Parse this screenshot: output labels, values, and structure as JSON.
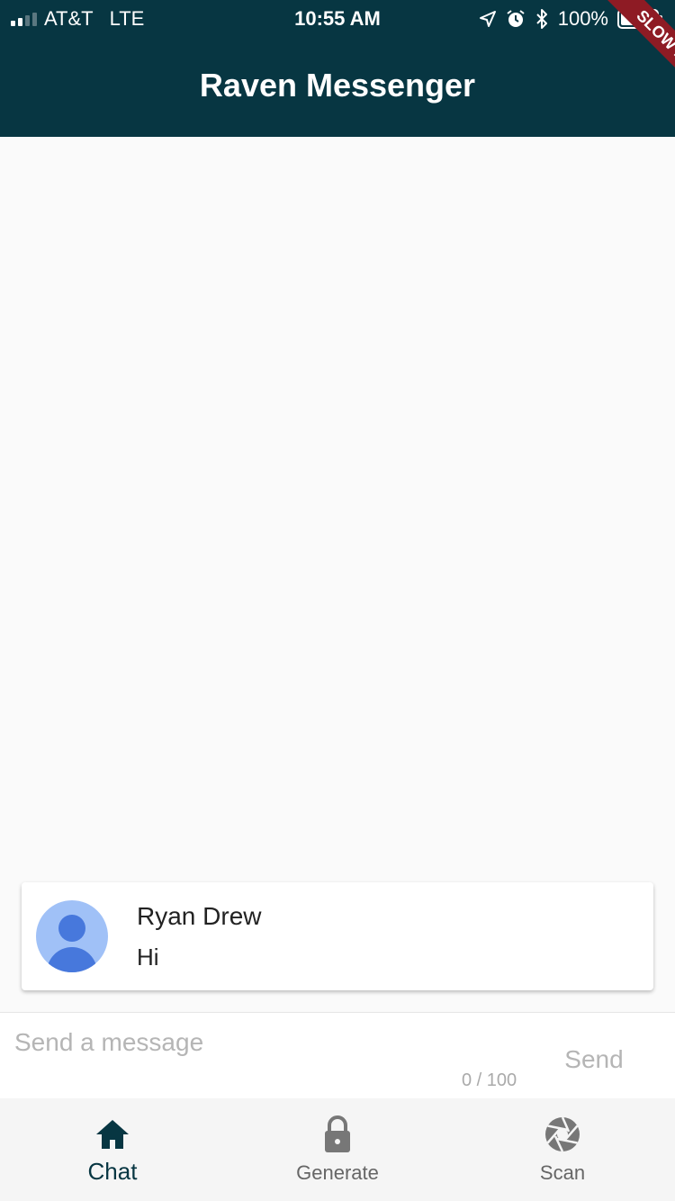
{
  "status_bar": {
    "carrier": "AT&T",
    "network": "LTE",
    "time": "10:55 AM",
    "battery": "100%",
    "battery_level": 1.0
  },
  "app_bar": {
    "title": "Raven Messenger"
  },
  "debug_banner": {
    "label": "SLOW MODE"
  },
  "messages": [
    {
      "sender": "Ryan Drew",
      "text": "Hi",
      "avatar_icon": "person-icon"
    }
  ],
  "composer": {
    "placeholder": "Send a message",
    "value": "",
    "counter": "0 / 100",
    "send_label": "Send"
  },
  "bottom_nav": {
    "items": [
      {
        "label": "Chat",
        "icon": "home-icon",
        "active": true
      },
      {
        "label": "Generate",
        "icon": "lock-icon",
        "active": false
      },
      {
        "label": "Scan",
        "icon": "camera-shutter-icon",
        "active": false
      }
    ]
  },
  "colors": {
    "primary": "#073642",
    "banner": "#8e1b24",
    "avatar_bg": "#a0c1f7",
    "avatar_fg": "#4778dc"
  }
}
